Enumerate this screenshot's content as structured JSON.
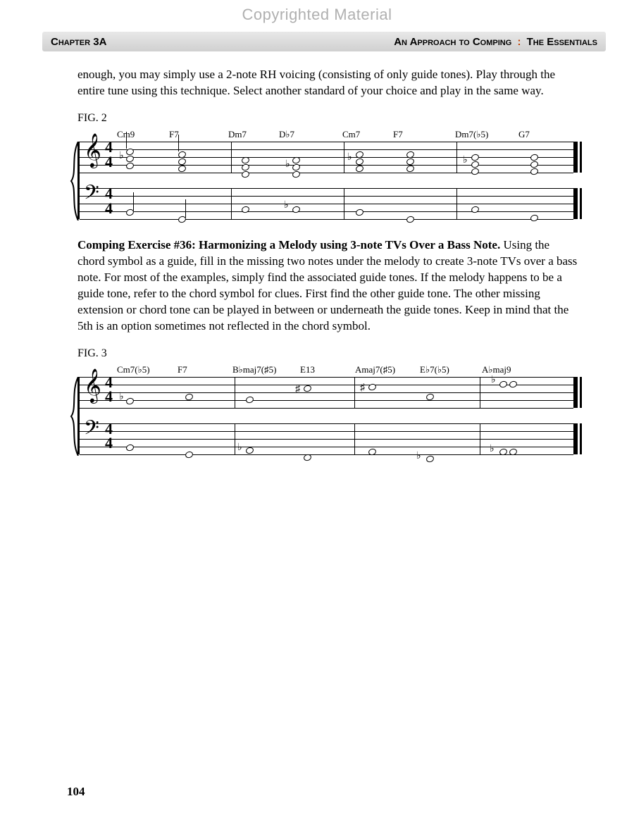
{
  "watermark": "Copyrighted Material",
  "header": {
    "chapter": "Chapter 3A",
    "title_prefix": "An Approach to Comping",
    "title_suffix": "The Essentials"
  },
  "intro_para": "enough, you may simply use a 2-note RH voicing (consisting of only guide tones). Play through the entire tune using this technique. Select another standard of your choice and play in the same way.",
  "fig2": {
    "label": "FIG. 2",
    "chords": [
      "Cm9",
      "F7",
      "Dm7",
      "D♭7",
      "Cm7",
      "F7",
      "Dm7(♭5)",
      "G7"
    ],
    "time_top": "4",
    "time_bot": "4"
  },
  "exercise": {
    "title": "Comping Exercise #36: Harmonizing a Melody using 3-note TVs Over a Bass Note.",
    "body": "Using the chord symbol as a guide, fill in the missing two notes under the melody to create 3-note TVs over a bass note. For most of the examples, simply find the associated guide tones. If the melody happens to be a guide tone, refer to the chord symbol for clues. First find the other guide tone. The other missing extension or chord tone can be played in between or underneath the guide tones. Keep in mind that the 5th is an option sometimes not reflected in the chord symbol."
  },
  "fig3": {
    "label": "FIG. 3",
    "chords": [
      "Cm7(♭5)",
      "F7",
      "B♭maj7(♯5)",
      "E13",
      "Amaj7(♯5)",
      "E♭7(♭5)",
      "A♭maj9",
      ""
    ],
    "time_top": "4",
    "time_bot": "4"
  },
  "page_number": "104"
}
